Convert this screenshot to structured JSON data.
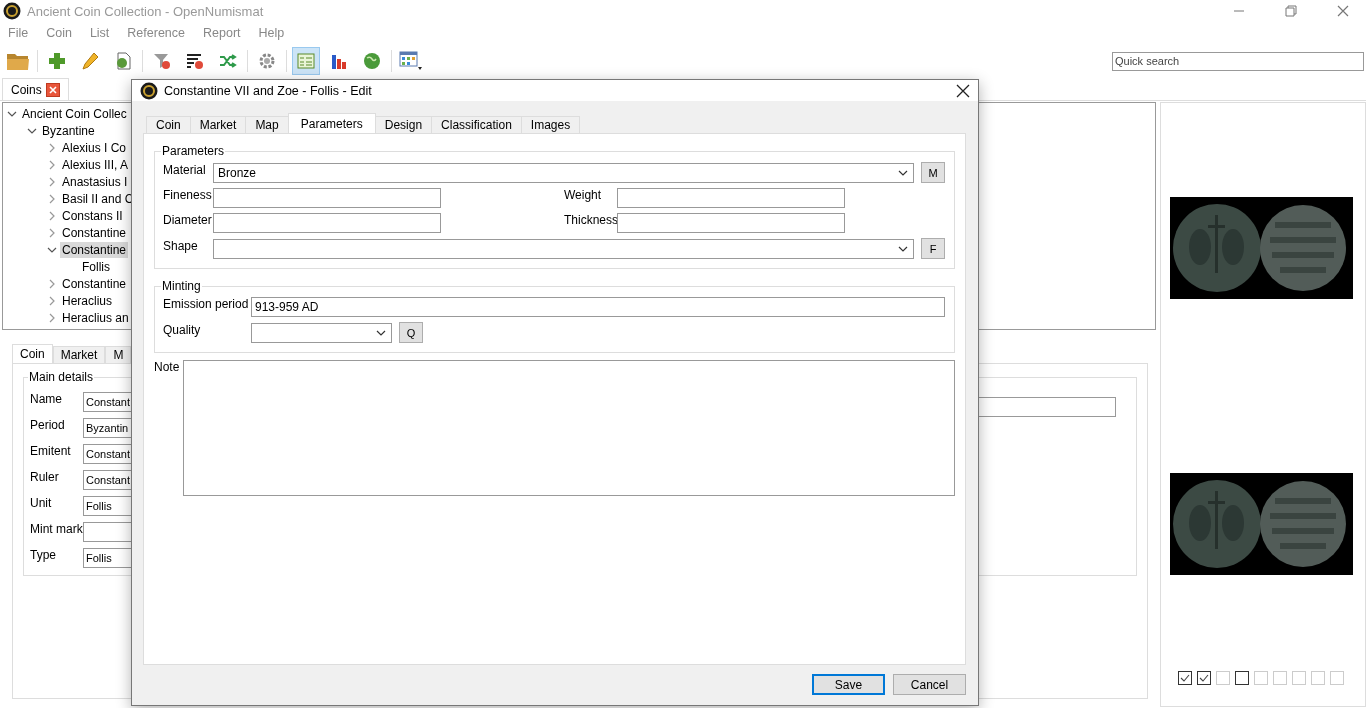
{
  "window": {
    "title": "Ancient Coin Collection - OpenNumismat"
  },
  "menu": [
    "File",
    "Coin",
    "List",
    "Reference",
    "Report",
    "Help"
  ],
  "toolbar": [
    {
      "kind": "open",
      "selected": false
    },
    {
      "kind": "add",
      "selected": false
    },
    {
      "kind": "edit",
      "selected": false
    },
    {
      "kind": "clone",
      "selected": false
    },
    {
      "kind": "clear-filter",
      "selected": false
    },
    {
      "kind": "clear-sort",
      "selected": false
    },
    {
      "kind": "random",
      "selected": false
    },
    {
      "kind": "settings",
      "selected": false
    },
    {
      "kind": "list-view",
      "selected": true
    },
    {
      "kind": "statistics",
      "selected": false
    },
    {
      "kind": "map",
      "selected": false
    },
    {
      "kind": "table-view",
      "selected": false
    }
  ],
  "quick_search": {
    "placeholder": "Quick search"
  },
  "collection_tab": {
    "label": "Coins"
  },
  "tree": [
    {
      "label": "Ancient Coin Collec",
      "expanded": true,
      "selected": false,
      "children": [
        {
          "label": "Byzantine",
          "expanded": true,
          "selected": false,
          "children": [
            {
              "label": "Alexius I Co",
              "expanded": false,
              "selected": false
            },
            {
              "label": "Alexius III, A",
              "expanded": false,
              "selected": false
            },
            {
              "label": "Anastasius I",
              "expanded": false,
              "selected": false
            },
            {
              "label": "Basil II and C",
              "expanded": false,
              "selected": false
            },
            {
              "label": "Constans II",
              "expanded": false,
              "selected": false
            },
            {
              "label": "Constantine",
              "expanded": false,
              "selected": false
            },
            {
              "label": "Constantine",
              "expanded": true,
              "selected": true,
              "children": [
                {
                  "label": "Follis",
                  "selected": false
                }
              ]
            },
            {
              "label": "Constantine",
              "expanded": false,
              "selected": false
            },
            {
              "label": "Heraclius",
              "expanded": false,
              "selected": false
            },
            {
              "label": "Heraclius an",
              "expanded": false,
              "selected": false
            }
          ]
        }
      ]
    }
  ],
  "details": {
    "tabs": [
      {
        "label": "Coin",
        "selected": true
      },
      {
        "label": "Market",
        "selected": false
      },
      {
        "label": "M",
        "selected": false
      }
    ],
    "group": "Main details",
    "fields": [
      {
        "label": "Name",
        "value": "Constant"
      },
      {
        "label": "Period",
        "value": "Byzantin"
      },
      {
        "label": "Emitent",
        "value": "Constant"
      },
      {
        "label": "Ruler",
        "value": "Constant"
      },
      {
        "label": "Unit",
        "value": "Follis"
      },
      {
        "label": "Mint mark"
      },
      {
        "label": "Type",
        "value": "Follis"
      }
    ]
  },
  "rating": [
    {
      "checked": true,
      "active": true
    },
    {
      "checked": true,
      "active": true
    },
    {
      "checked": false,
      "active": false
    },
    {
      "checked": false,
      "active": true
    },
    {
      "checked": false,
      "active": false
    },
    {
      "checked": false,
      "active": false
    },
    {
      "checked": false,
      "active": false
    },
    {
      "checked": false,
      "active": false
    },
    {
      "checked": false,
      "active": false
    }
  ],
  "dialog": {
    "title": "Constantine VII and Zoe - Follis - Edit",
    "tabs": [
      {
        "label": "Coin",
        "selected": false
      },
      {
        "label": "Market",
        "selected": false
      },
      {
        "label": "Map",
        "selected": false
      },
      {
        "label": "Parameters",
        "selected": true
      },
      {
        "label": "Design",
        "selected": false
      },
      {
        "label": "Classification",
        "selected": false
      },
      {
        "label": "Images",
        "selected": false
      }
    ],
    "parameters": {
      "title": "Parameters",
      "rows": [
        [
          {
            "kind": "combo",
            "label": "Material",
            "value": "Bronze",
            "button": "M"
          }
        ],
        [
          {
            "kind": "input",
            "label": "Fineness"
          },
          {
            "kind": "input",
            "label": "Weight"
          }
        ],
        [
          {
            "kind": "input",
            "label": "Diameter"
          },
          {
            "kind": "input",
            "label": "Thickness"
          }
        ],
        [
          {
            "kind": "combo",
            "label": "Shape",
            "button": "F"
          }
        ]
      ]
    },
    "minting": {
      "title": "Minting",
      "rows": [
        [
          {
            "kind": "input",
            "label": "Emission period",
            "value": "913-959 AD"
          }
        ],
        [
          {
            "kind": "small-combo",
            "label": "Quality",
            "button": "Q"
          }
        ]
      ]
    },
    "note": {
      "label": "Note"
    },
    "buttons": [
      {
        "label": "Save",
        "default": true
      },
      {
        "label": "Cancel",
        "default": false
      }
    ]
  }
}
